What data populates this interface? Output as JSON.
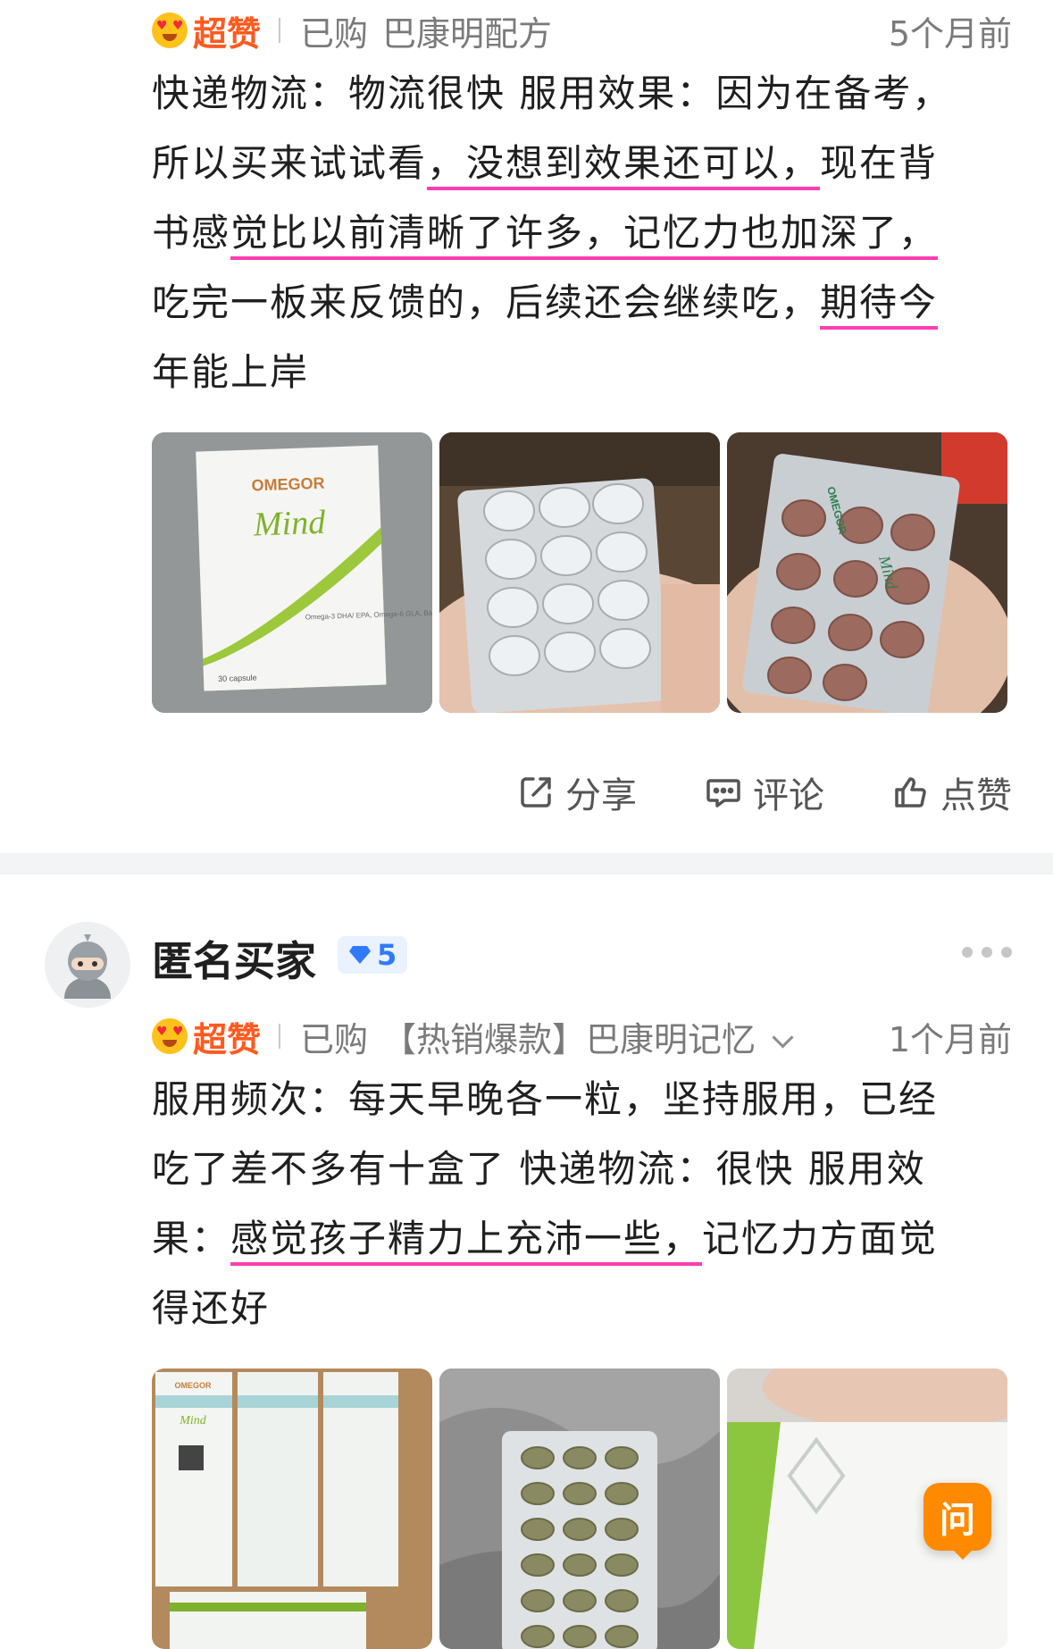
{
  "review1": {
    "badge": "超赞",
    "purchase_label": "已购",
    "product": "巴康明配方",
    "time": "5个月前",
    "text": {
      "line1": "快递物流：物流很快 服用效果：因为在备考，",
      "line2_a": "所以买来试试看",
      "line2_hl": "，没想到效果还可以，",
      "line2_b": "现在背",
      "line3_a": "书感",
      "line3_hl": "觉比以前清晰了许多，记忆力也加深了，",
      "line4_a": "吃完一板来反馈的，后续还会继续吃，",
      "line4_hl": "期待今",
      "line5": "年能上岸"
    },
    "photos": [
      {
        "box_brand": "OMEGOR",
        "box_product": "Mind",
        "box_desc": "Omega-3 DHA/ EPA, Omega-6 GLA, Bacopa, Zinco e Vitamine B",
        "box_qty": "30 capsule"
      },
      {},
      {
        "foil_brand": "OMEGOR",
        "foil_product": "Mind"
      }
    ],
    "actions": {
      "share": "分享",
      "comment": "评论",
      "like": "点赞"
    }
  },
  "review2": {
    "username": "匿名买家",
    "level": "5",
    "badge": "超赞",
    "purchase_label": "已购",
    "product": "【热销爆款】巴康明记忆",
    "time": "1个月前",
    "text": {
      "line1": "服用频次：每天早晚各一粒，坚持服用，已经",
      "line2": "吃了差不多有十盒了 快递物流：很快 服用效",
      "line3_a": "果：",
      "line3_hl": "感觉孩子精力上充沛一些，",
      "line3_b": "记忆力方面觉",
      "line4": "得还好"
    },
    "photos": [
      {
        "box_brand": "OMEGOR",
        "box_product": "Mind"
      },
      {},
      {}
    ]
  },
  "float_button": {
    "label": "问"
  },
  "colors": {
    "badge": "#ff5a1f",
    "highlight": "#ff3db4",
    "level": "#2f7bf6",
    "ask": "#ff8a00"
  }
}
